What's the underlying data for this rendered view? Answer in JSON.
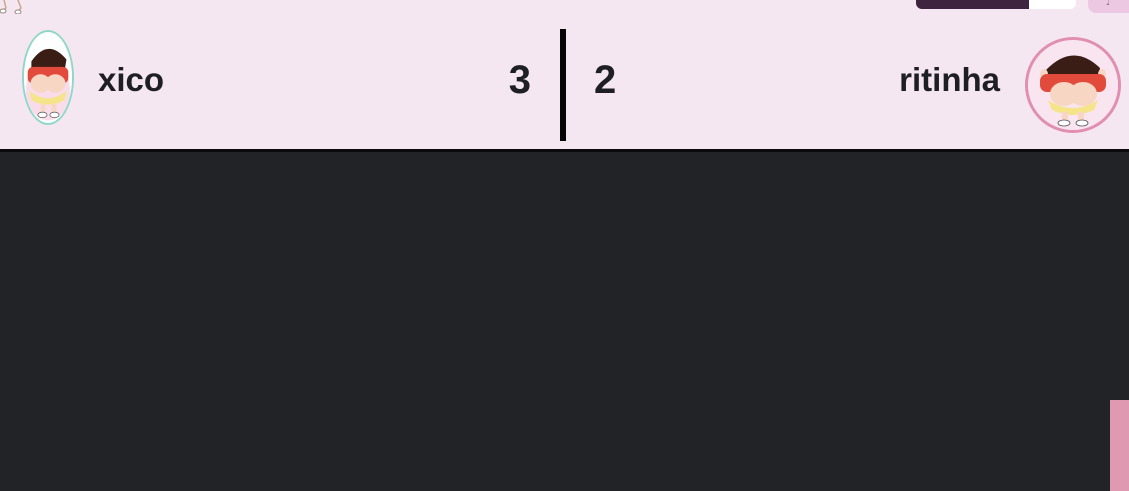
{
  "players": {
    "left": {
      "name": "xico",
      "score": "3",
      "avatar": "shinchan-butt-avatar"
    },
    "right": {
      "name": "ritinha",
      "score": "2",
      "avatar": "shinchan-butt-avatar"
    }
  },
  "colors": {
    "scorebar_bg": "#f5e7f2",
    "game_bg": "#212327",
    "text": "#1e1f24",
    "divider": "#050505",
    "left_avatar_border": "#8fd8c8",
    "right_avatar_border": "#e08fb0",
    "side_tab": "#df9ab1"
  }
}
